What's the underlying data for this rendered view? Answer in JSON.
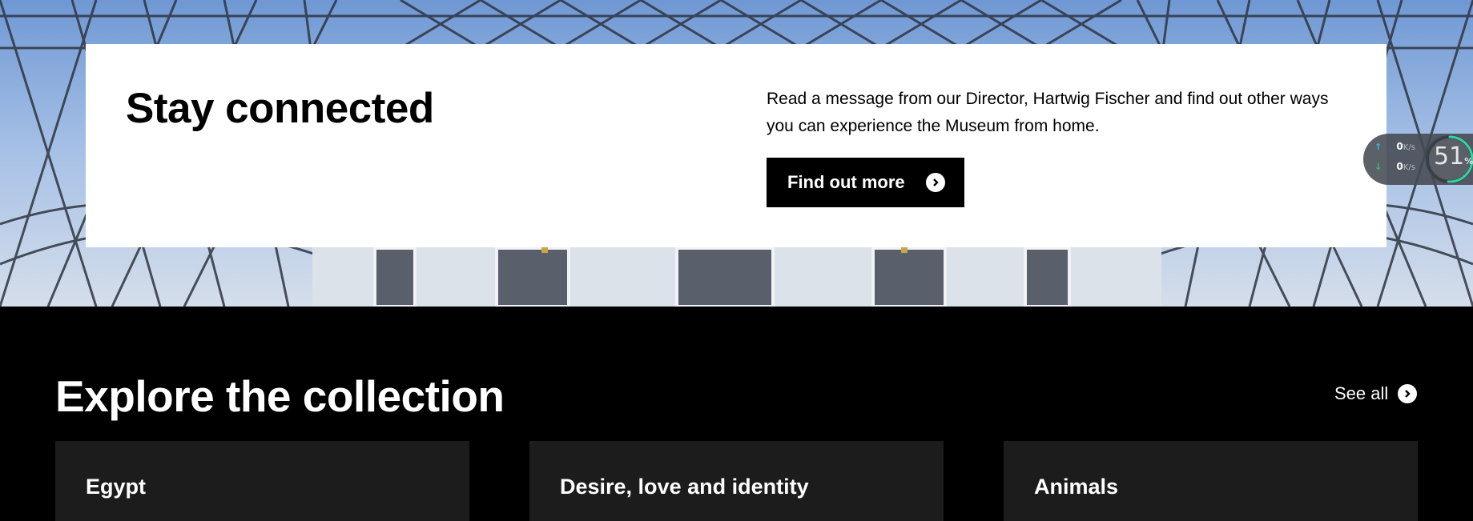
{
  "hero": {
    "title": "Stay connected",
    "text": "Read a message from our Director, Hartwig Fischer and find out other ways you can experience the Museum from home.",
    "button_label": "Find out more"
  },
  "network_widget": {
    "upload": "0",
    "upload_unit": "K/s",
    "download": "0",
    "download_unit": "K/s",
    "percent": "51",
    "percent_sign": "%",
    "percent_value": 51
  },
  "collection": {
    "title": "Explore the collection",
    "see_all_label": "See all",
    "cards": [
      {
        "label": "Egypt"
      },
      {
        "label": "Desire, love and identity"
      },
      {
        "label": "Animals"
      }
    ]
  },
  "colors": {
    "background": "#000000",
    "card_bg": "#1c1c1c",
    "hero_card": "#ffffff",
    "gauge_accent": "#2fd6a0"
  },
  "icons": {
    "arrow": "arrow-right-circle-icon",
    "upload": "upload-arrow-icon",
    "download": "download-arrow-icon"
  }
}
